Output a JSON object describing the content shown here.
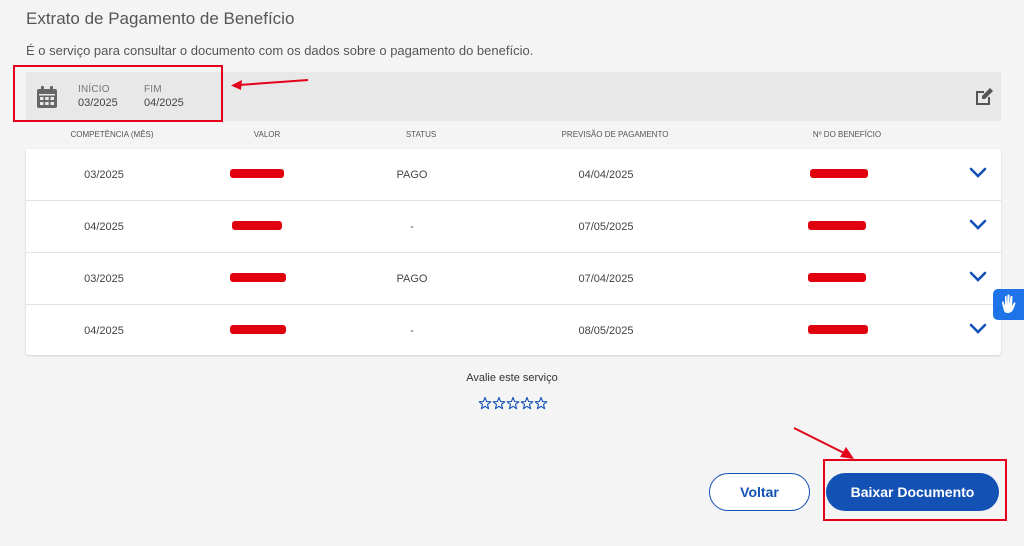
{
  "page": {
    "title": "Extrato de Pagamento de Benefício",
    "description": "É o serviço para consultar o documento com os dados sobre o pagamento do benefício."
  },
  "period": {
    "icon": "calendar-icon",
    "start_label": "INÍCIO",
    "start_value": "03/2025",
    "end_label": "FIM",
    "end_value": "04/2025",
    "edit_icon": "edit-icon"
  },
  "table": {
    "headers": {
      "competencia": "COMPETÊNCIA (MÊS)",
      "valor": "VALOR",
      "status": "STATUS",
      "previsao": "PREVISÃO DE PAGAMENTO",
      "beneficio": "Nº DO BENEFÍCIO"
    },
    "rows": [
      {
        "competencia": "03/2025",
        "status": "PAGO",
        "previsao": "04/04/2025"
      },
      {
        "competencia": "04/2025",
        "status": "-",
        "previsao": "07/05/2025"
      },
      {
        "competencia": "03/2025",
        "status": "PAGO",
        "previsao": "07/04/2025"
      },
      {
        "competencia": "04/2025",
        "status": "-",
        "previsao": "08/05/2025"
      }
    ]
  },
  "rating": {
    "label": "Avalie este serviço",
    "star_count": 5
  },
  "buttons": {
    "back": "Voltar",
    "download": "Baixar Documento"
  },
  "colors": {
    "primary": "#1351b4",
    "annotation": "#e4001b",
    "redaction": "#e0000e",
    "a11y": "#1e73e8"
  }
}
